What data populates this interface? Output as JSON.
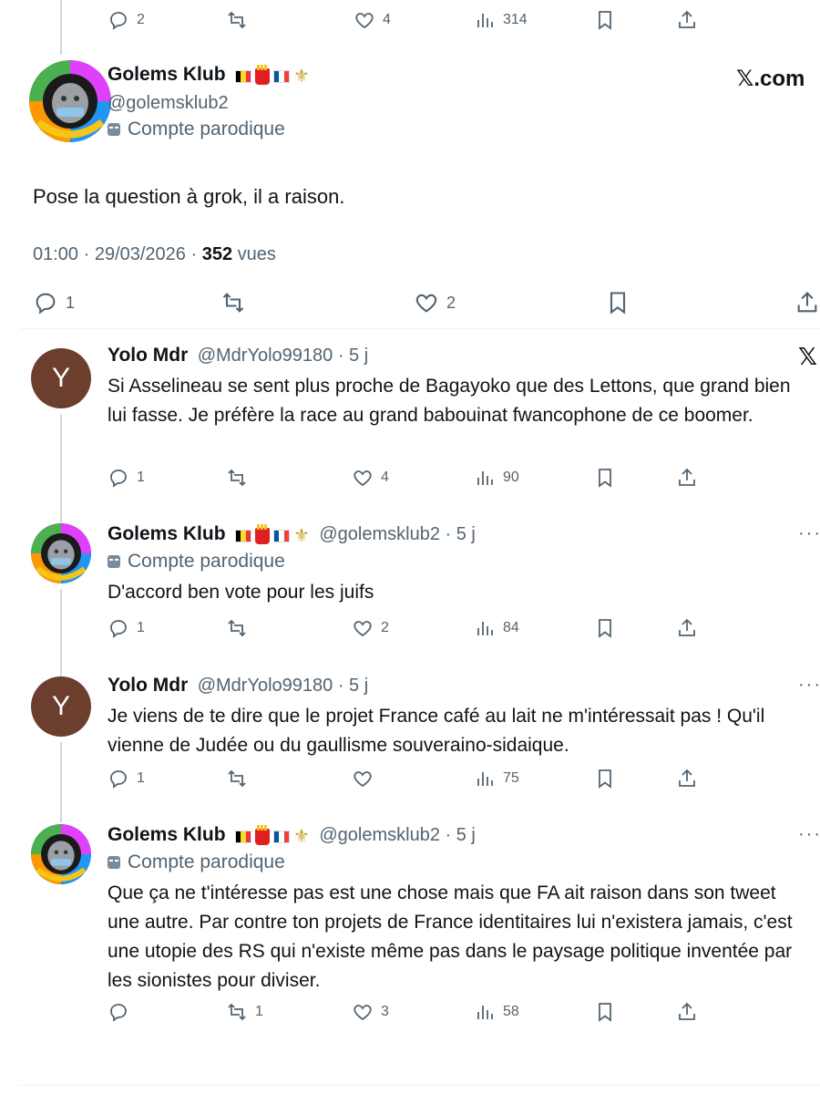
{
  "top_actions": {
    "reply": "2",
    "like": "4",
    "views": "314"
  },
  "main_tweet": {
    "name": "Golems Klub",
    "handle": "@golemsklub2",
    "badge": "Compte parodique",
    "text": "Pose la question à grok, il a raison.",
    "time": "01:00 · 29/03/2026 ·",
    "views_count": "352",
    "views_label": "vues",
    "site": "𝕏.com",
    "actions": {
      "reply": "1",
      "like": "2"
    }
  },
  "replies": [
    {
      "name": "Yolo Mdr",
      "handle": "@MdrYolo99180 · 5 j",
      "avatar_letter": "Y",
      "text": "Si Asselineau se sent plus proche de Bagayoko que des Lettons, que grand bien lui fasse. Je préfère la race au grand babouinat fwancophone de ce boomer.",
      "actions": {
        "reply": "1",
        "retweet": "",
        "like": "4",
        "views": "90"
      }
    },
    {
      "name": "Golems Klub",
      "handle": "@golemsklub2 · 5 j",
      "badge": "Compte parodique",
      "text": "D'accord ben vote pour les juifs",
      "actions": {
        "reply": "1",
        "retweet": "",
        "like": "2",
        "views": "84"
      }
    },
    {
      "name": "Yolo Mdr",
      "handle": "@MdrYolo99180 · 5 j",
      "avatar_letter": "Y",
      "text": "Je viens de te dire que le projet France café au lait ne m'intéressait pas ! Qu'il vienne de Judée ou du gaullisme souveraino-sidaique.",
      "actions": {
        "reply": "1",
        "retweet": "",
        "like": "",
        "views": "75"
      }
    },
    {
      "name": "Golems Klub",
      "handle": "@golemsklub2 · 5 j",
      "badge": "Compte parodique",
      "text": "Que ça ne t'intéresse pas est une chose mais que FA ait raison dans son tweet une autre. Par contre ton projets de France identitaires lui n'existera jamais, c'est une utopie des RS qui n'existe même pas dans le paysage politique inventée par les sionistes pour diviser.",
      "actions": {
        "reply": "",
        "retweet": "1",
        "like": "3",
        "views": "58"
      }
    }
  ],
  "colors": {
    "text": "#0f1419",
    "muted": "#536471",
    "line": "#cfd9de",
    "avatar_y": "#6b3e2e"
  }
}
